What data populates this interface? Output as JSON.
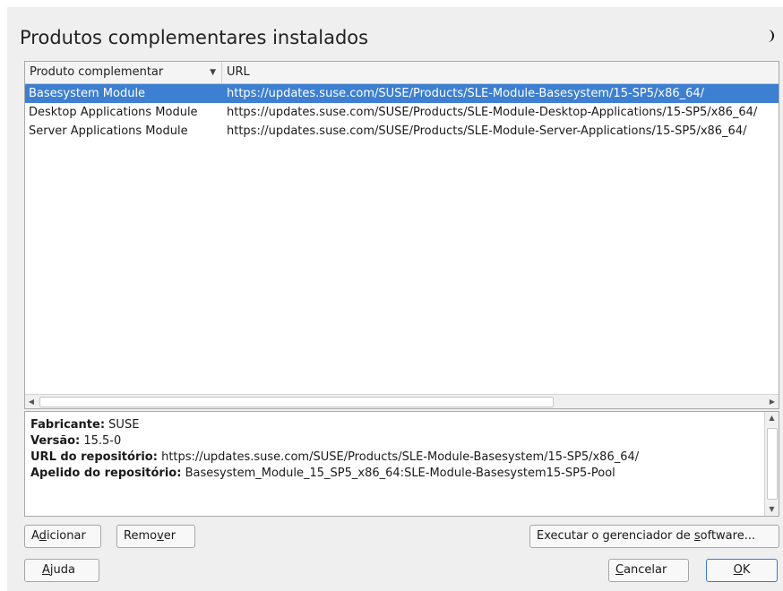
{
  "window": {
    "title": "Produtos complementares instalados",
    "theme_icon": "half-moon-icon"
  },
  "table": {
    "columns": [
      {
        "label": "Produto complementar",
        "sorted": "descending"
      },
      {
        "label": "URL"
      }
    ],
    "rows": [
      {
        "product": "Basesystem Module",
        "url": "https://updates.suse.com/SUSE/Products/SLE-Module-Basesystem/15-SP5/x86_64/",
        "selected": true
      },
      {
        "product": "Desktop Applications Module",
        "url": "https://updates.suse.com/SUSE/Products/SLE-Module-Desktop-Applications/15-SP5/x86_64/",
        "selected": false
      },
      {
        "product": "Server Applications Module",
        "url": "https://updates.suse.com/SUSE/Products/SLE-Module-Server-Applications/15-SP5/x86_64/",
        "selected": false
      }
    ]
  },
  "details": {
    "vendor_label": "Fabricante:",
    "vendor_value": "SUSE",
    "version_label": "Versão:",
    "version_value": "15.5-0",
    "repo_url_label": "URL do repositório:",
    "repo_url_value": "https://updates.suse.com/SUSE/Products/SLE-Module-Basesystem/15-SP5/x86_64/",
    "repo_alias_label": "Apelido do repositório:",
    "repo_alias_value": "Basesystem_Module_15_SP5_x86_64:SLE-Module-Basesystem15-SP5-Pool"
  },
  "buttons": {
    "add_pre": "A",
    "add_key": "d",
    "add_post": "icionar",
    "remove_pre": "Remo",
    "remove_key": "v",
    "remove_post": "er",
    "run_pre": "Executar o gerenciador de ",
    "run_key": "s",
    "run_post": "oftware...",
    "help_pre": "",
    "help_key": "A",
    "help_post": "juda",
    "cancel_pre": "",
    "cancel_key": "C",
    "cancel_post": "ancelar",
    "ok_pre": "",
    "ok_key": "O",
    "ok_post": "K"
  },
  "colors": {
    "selection": "#3d7fd0",
    "default_button_border": "#3a7ad3"
  }
}
